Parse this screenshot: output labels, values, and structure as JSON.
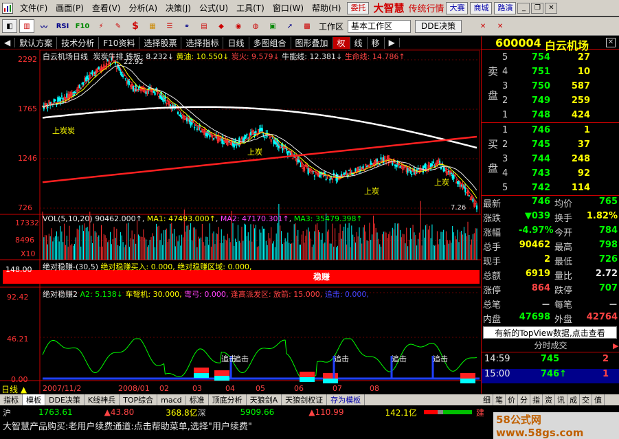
{
  "menu": [
    "文件(F)",
    "画面(P)",
    "查看(V)",
    "分析(A)",
    "决策(J)",
    "公式(U)",
    "工具(T)",
    "窗口(W)",
    "帮助(H)"
  ],
  "menu_buttons": {
    "entrust": "委托",
    "dasai": "大赛",
    "mall": "商城",
    "road": "路演"
  },
  "brand": {
    "name": "大智慧",
    "sub": "传统行情"
  },
  "toolbar": {
    "icons": [
      "RSI",
      "F10",
      "$"
    ],
    "workspace_label": "工作区",
    "workspace_value": "基本工作区",
    "dde_label": "DDE决策"
  },
  "tabstrip": [
    "默认方案",
    "技术分析",
    "F10资料",
    "选择股票",
    "选择指标",
    "日线",
    "多图组合",
    "图形叠加",
    "权",
    "线",
    "移"
  ],
  "stock": {
    "code": "600004",
    "name": "白云机场"
  },
  "main_chart": {
    "title": "白云机场日线",
    "indicator": "炭炭牛排",
    "params": [
      {
        "k": "铁板",
        "v": "8.232↓",
        "c": "#e8e8e8"
      },
      {
        "k": "黄油",
        "v": "10.550↓",
        "c": "#ffff00"
      },
      {
        "k": "炭火",
        "v": "9.579↓",
        "c": "#ff4444"
      },
      {
        "k": "牛能线",
        "v": "12.381↓",
        "c": "#e8e8e8"
      },
      {
        "k": "生命线",
        "v": "14.786↑",
        "c": "#ff4444"
      }
    ],
    "yticks": [
      "2292",
      "1765",
      "1246",
      "726"
    ],
    "high_label": "22.92",
    "low_label": "7.26",
    "annotations": [
      "上炭炭",
      "上炭",
      "上炭",
      "上炭"
    ]
  },
  "vol_chart": {
    "title": "VOL(5,10,20)",
    "vol": "90462.000↑",
    "ma1": "MA1: 47493.000↑",
    "ma2": "MA2: 47170.301↑",
    "ma3": "MA3: 35479.398↑",
    "yticks": [
      "17332",
      "8496"
    ],
    "unit": "X10"
  },
  "band_chart": {
    "title": "绝对稳赚-(30,5)",
    "buy": "绝对稳赚买入: 0.000,",
    "zone": "绝对稳赚区域: 0.000,",
    "axis": "148.00",
    "center": "稳赚"
  },
  "osc_chart": {
    "title": "绝对稳赚2",
    "a2": "A2: 5.138↓",
    "car": "车弩机: 30.000,",
    "bow": "弯弓: 0.000,",
    "high": "逢高派发区: 放箭: 15.000,",
    "chase": "追击: 0.000,",
    "yticks": [
      "92.42",
      "46.21",
      "0.00"
    ],
    "marks": [
      "追击",
      "追击",
      "追击",
      "追击",
      "追击"
    ]
  },
  "xaxis": {
    "labels": [
      "2007/11/2",
      "2008/01",
      "02",
      "03",
      "04",
      "05",
      "06",
      "07",
      "08"
    ],
    "period": "日线"
  },
  "chart_data": {
    "type": "candlestick",
    "title": "白云机场日线",
    "y_range": [
      7.26,
      22.92
    ],
    "series": [
      {
        "name": "铁板",
        "last": 8.232
      },
      {
        "name": "黄油",
        "last": 10.55
      },
      {
        "name": "炭火",
        "last": 9.579
      },
      {
        "name": "牛能线",
        "last": 12.381
      },
      {
        "name": "生命线",
        "last": 14.786
      }
    ]
  },
  "orderbook": {
    "sell_label": "卖盘",
    "buy_label": "买盘",
    "sell": [
      {
        "lvl": "5",
        "p": "754",
        "v": "27"
      },
      {
        "lvl": "4",
        "p": "751",
        "v": "10"
      },
      {
        "lvl": "3",
        "p": "750",
        "v": "587"
      },
      {
        "lvl": "2",
        "p": "749",
        "v": "259"
      },
      {
        "lvl": "1",
        "p": "748",
        "v": "424"
      }
    ],
    "buy": [
      {
        "lvl": "1",
        "p": "746",
        "v": "1"
      },
      {
        "lvl": "2",
        "p": "745",
        "v": "37"
      },
      {
        "lvl": "3",
        "p": "744",
        "v": "248"
      },
      {
        "lvl": "4",
        "p": "743",
        "v": "92"
      },
      {
        "lvl": "5",
        "p": "742",
        "v": "114"
      }
    ]
  },
  "quote": [
    {
      "l1": "最新",
      "v1": "746",
      "c1": "#00ff00",
      "l2": "均价",
      "v2": "765",
      "c2": "#00ff00"
    },
    {
      "l1": "涨跌",
      "v1": "▼039",
      "c1": "#00ff00",
      "l2": "换手",
      "v2": "1.82%",
      "c2": "#ffff00"
    },
    {
      "l1": "涨幅",
      "v1": "-4.97%",
      "c1": "#00ff00",
      "l2": "今开",
      "v2": "784",
      "c2": "#00ff00"
    },
    {
      "l1": "总手",
      "v1": "90462",
      "c1": "#ffff00",
      "l2": "最高",
      "v2": "798",
      "c2": "#00ff00"
    },
    {
      "l1": "现手",
      "v1": "2",
      "c1": "#ffff00",
      "l2": "最低",
      "v2": "726",
      "c2": "#00ff00"
    },
    {
      "l1": "总额",
      "v1": "6919",
      "c1": "#ffff00",
      "l2": "量比",
      "v2": "2.72",
      "c2": "#e8e8e8"
    },
    {
      "l1": "涨停",
      "v1": "864",
      "c1": "#ff4444",
      "l2": "跌停",
      "v2": "707",
      "c2": "#00ff00"
    },
    {
      "l1": "总笔",
      "v1": "－",
      "c1": "#e8e8e8",
      "l2": "每笔",
      "v2": "－",
      "c2": "#e8e8e8"
    },
    {
      "l1": "内盘",
      "v1": "47698",
      "c1": "#00ff00",
      "l2": "外盘",
      "v2": "42764",
      "c2": "#ff4444"
    }
  ],
  "topview": "有新的TopView数据,点击查看",
  "trade_header": "分时成交",
  "trades": [
    {
      "t": "14:59",
      "p": "745",
      "v": "2"
    },
    {
      "t": "15:00",
      "p": "746↑",
      "v": "1"
    }
  ],
  "side_tabs": [
    "细",
    "笔",
    "价",
    "分",
    "指",
    "资",
    "讯",
    "成",
    "交",
    "值"
  ],
  "bottom_tabs": [
    "指标",
    "模板",
    "DDE决策",
    "K线神兵",
    "TOP综合",
    "macd",
    "标准",
    "顶底分析",
    "天狼剑A",
    "天狼剑权证",
    "存为模板"
  ],
  "ticker": [
    {
      "t": "沪",
      "c": "#e8e8e8"
    },
    {
      "t": "1763.61",
      "c": "#00ff00"
    },
    {
      "t": "▲43.80",
      "c": "#ff4444"
    },
    {
      "t": "368.8亿",
      "c": "#ffff00"
    },
    {
      "t": "深",
      "c": "#e8e8e8"
    },
    {
      "t": "5909.66",
      "c": "#00ff00"
    },
    {
      "t": "▲110.99",
      "c": "#ff4444"
    },
    {
      "t": "142.1亿",
      "c": "#ffff00"
    },
    {
      "t": "建",
      "c": "#ff4444"
    }
  ],
  "scroll_text": "大智慧产品购买:老用户续费通道:点击帮助菜单,选择\"用户续费\"",
  "watermark": "58公式网 www.58gs.com"
}
